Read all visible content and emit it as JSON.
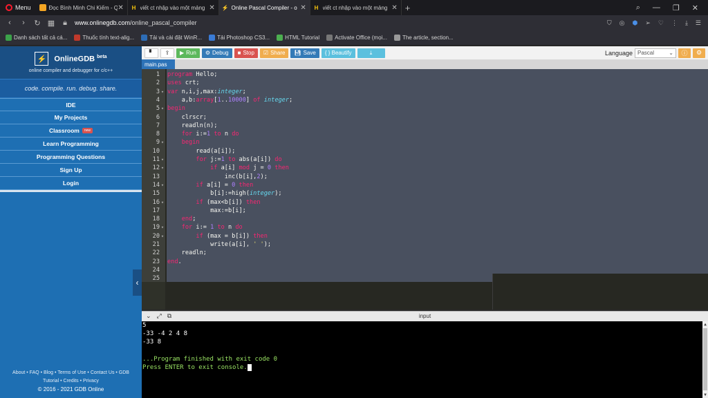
{
  "browser": {
    "menu_label": "Menu",
    "tabs": [
      {
        "title": "Đọc Bình Minh Chi Kiếm - Q",
        "favicon_color": "#f5a623"
      },
      {
        "title": "viết ct nhập vào một mảng",
        "favicon_color": "#f4c20d"
      },
      {
        "title": "Online Pascal Compiler - o",
        "favicon_color": "#8a5cf6"
      },
      {
        "title": "viết ct nhập vào một mảng",
        "favicon_color": "#f4c20d"
      }
    ],
    "url_host": "www.onlinegdb.com",
    "url_path": "/online_pascal_compiler",
    "bookmarks": [
      {
        "label": "Danh sách tất cả cá...",
        "color": "#3ca24a"
      },
      {
        "label": "Thuốc tính text-alig...",
        "color": "#c0392b"
      },
      {
        "label": "Tải và cài đặt WinR...",
        "color": "#2d6cb5"
      },
      {
        "label": "Tải Photoshop CS3...",
        "color": "#3a7bd5"
      },
      {
        "label": "HTML Tutorial",
        "color": "#4caf50"
      },
      {
        "label": "Activate Office (mọi...",
        "color": "#777777"
      },
      {
        "label": "The article, section...",
        "color": "#999999"
      }
    ]
  },
  "sidebar": {
    "brand": "OnlineGDB",
    "brand_badge": "beta",
    "brand_sub": "online compiler and debugger for c/c++",
    "tagline": "code. compile. run. debug. share.",
    "items": [
      {
        "label": "IDE"
      },
      {
        "label": "My Projects"
      },
      {
        "label": "Classroom",
        "badge": "new"
      },
      {
        "label": "Learn Programming"
      },
      {
        "label": "Programming Questions"
      },
      {
        "label": "Sign Up"
      },
      {
        "label": "Login"
      }
    ],
    "footer_line1": "About • FAQ • Blog • Terms of Use • Contact Us • GDB",
    "footer_line2": "Tutorial • Credits • Privacy",
    "copyright": "© 2016 - 2021 GDB Online"
  },
  "toolbar": {
    "run": "Run",
    "debug": "Debug",
    "stop": "Stop",
    "share": "Share",
    "save": "Save",
    "beautify": "{ } Beautify",
    "language_label": "Language",
    "language_value": "Pascal"
  },
  "editor": {
    "file_tab": "main.pas",
    "lines": [
      "1",
      "2",
      "3",
      "4",
      "5",
      "6",
      "7",
      "8",
      "9",
      "10",
      "11",
      "12",
      "13",
      "14",
      "15",
      "16",
      "17",
      "18",
      "19",
      "20",
      "21",
      "22",
      "23",
      "24",
      "25"
    ]
  },
  "console": {
    "title": "input",
    "lines": [
      "5",
      "-33 -4 2 4 8",
      "-33 8",
      "",
      "...Program finished with exit code 0",
      "Press ENTER to exit console."
    ]
  }
}
